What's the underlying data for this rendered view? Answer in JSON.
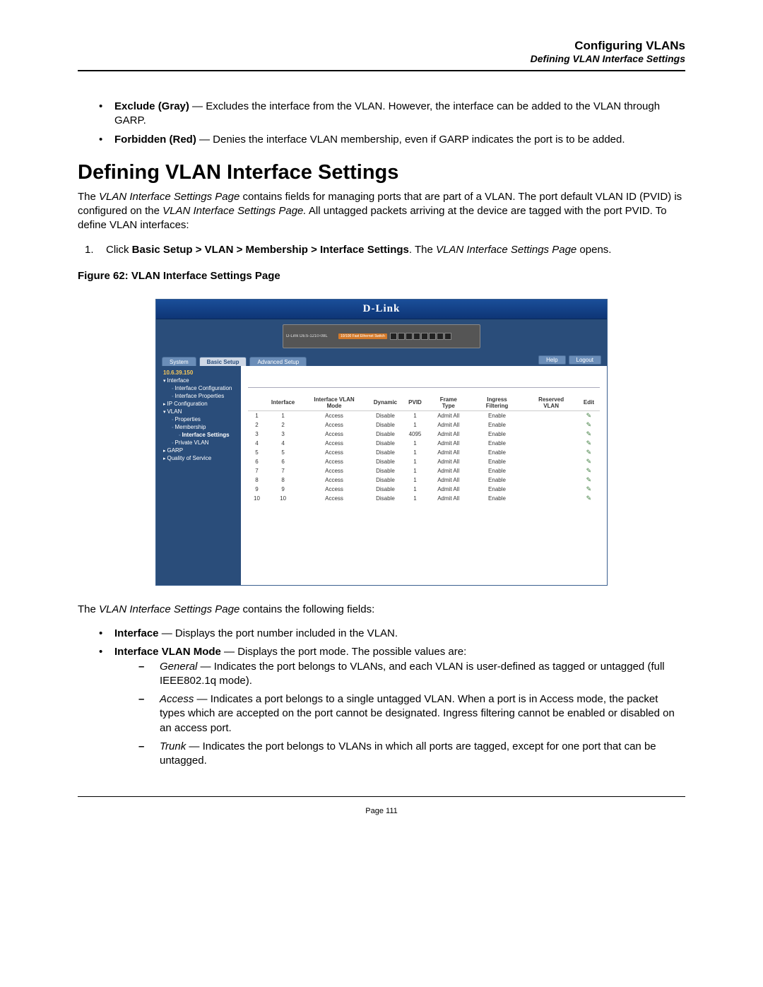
{
  "header": {
    "title": "Configuring VLANs",
    "subtitle": "Defining VLAN Interface Settings"
  },
  "topBullets": {
    "b1_bold": "Exclude (Gray)",
    "b1_rest": " — Excludes the interface from the VLAN. However, the interface can be added to the VLAN through GARP.",
    "b2_bold": "Forbidden (Red)",
    "b2_rest": " — Denies the interface VLAN membership, even if GARP indicates the port is to be added."
  },
  "sectionHeading": "Defining VLAN Interface Settings",
  "introPara": {
    "t1": "The ",
    "i1": "VLAN Interface Settings Page",
    "t2": " contains fields for managing ports that are part of a VLAN. The port default VLAN ID (PVID) is configured on the ",
    "i2": "VLAN Interface Settings Page.",
    "t3": " All untagged packets arriving at the device are tagged with the port PVID. To define VLAN interfaces:"
  },
  "step1": {
    "num": "1.",
    "t1": "Click ",
    "b1": "Basic Setup > VLAN > Membership > Interface Settings",
    "t2": ". The ",
    "i1": "VLAN Interface Settings Page",
    "t3": " opens."
  },
  "figureCaption": "Figure 62:  VLAN Interface Settings Page",
  "screenshot": {
    "logo": "D-Link",
    "deviceBrand": "D-Link DES-1210-08L",
    "portBadge": "10/100 Fast Ethernet Switch",
    "tabs": {
      "system": "System",
      "basic": "Basic Setup",
      "advanced": "Advanced Setup"
    },
    "buttons": {
      "help": "Help",
      "logout": "Logout"
    },
    "sidebar": {
      "ip": "10.6.39.150",
      "items": [
        {
          "lvl": 1,
          "open": true,
          "label": "Interface"
        },
        {
          "lvl": 2,
          "label": "Interface Configuration"
        },
        {
          "lvl": 2,
          "label": "Interface Properties"
        },
        {
          "lvl": 1,
          "open": false,
          "label": "IP Configuration"
        },
        {
          "lvl": 1,
          "open": true,
          "label": "VLAN"
        },
        {
          "lvl": 2,
          "label": "Properties"
        },
        {
          "lvl": 2,
          "label": "Membership"
        },
        {
          "lvl": 3,
          "label": "Interface Settings",
          "active": true
        },
        {
          "lvl": 2,
          "label": "Private VLAN"
        },
        {
          "lvl": 1,
          "open": false,
          "label": "GARP"
        },
        {
          "lvl": 1,
          "open": false,
          "label": "Quality of Service"
        }
      ]
    },
    "table": {
      "headers": [
        "",
        "Interface",
        "Interface VLAN Mode",
        "Dynamic",
        "PVID",
        "Frame Type",
        "Ingress Filtering",
        "Reserved VLAN",
        "Edit"
      ],
      "rows": [
        [
          "1",
          "1",
          "Access",
          "Disable",
          "1",
          "Admit All",
          "Enable",
          "",
          ""
        ],
        [
          "2",
          "2",
          "Access",
          "Disable",
          "1",
          "Admit All",
          "Enable",
          "",
          ""
        ],
        [
          "3",
          "3",
          "Access",
          "Disable",
          "4095",
          "Admit All",
          "Enable",
          "",
          ""
        ],
        [
          "4",
          "4",
          "Access",
          "Disable",
          "1",
          "Admit All",
          "Enable",
          "",
          ""
        ],
        [
          "5",
          "5",
          "Access",
          "Disable",
          "1",
          "Admit All",
          "Enable",
          "",
          ""
        ],
        [
          "6",
          "6",
          "Access",
          "Disable",
          "1",
          "Admit All",
          "Enable",
          "",
          ""
        ],
        [
          "7",
          "7",
          "Access",
          "Disable",
          "1",
          "Admit All",
          "Enable",
          "",
          ""
        ],
        [
          "8",
          "8",
          "Access",
          "Disable",
          "1",
          "Admit All",
          "Enable",
          "",
          ""
        ],
        [
          "9",
          "9",
          "Access",
          "Disable",
          "1",
          "Admit All",
          "Enable",
          "",
          ""
        ],
        [
          "10",
          "10",
          "Access",
          "Disable",
          "1",
          "Admit All",
          "Enable",
          "",
          ""
        ]
      ]
    }
  },
  "afterFig": {
    "t1": "The ",
    "i1": "VLAN Interface Settings Page",
    "t2": " contains the following fields:"
  },
  "fieldBullets": {
    "b1_bold": "Interface",
    "b1_rest": " — Displays the port number included in the VLAN.",
    "b2_bold": "Interface VLAN Mode",
    "b2_rest": " — Displays the port mode. The possible values are:"
  },
  "modeDash": {
    "d1_i": "General",
    "d1_rest": " — Indicates the port belongs to VLANs, and each VLAN is user-defined as tagged or untagged (full IEEE802.1q mode).",
    "d2_i": "Access",
    "d2_rest": " — Indicates a port belongs to a single untagged VLAN. When a port is in Access mode, the packet types which are accepted on the port cannot be designated. Ingress filtering cannot be enabled or disabled on an access port.",
    "d3_i": "Trunk",
    "d3_rest": " — Indicates the port belongs to VLANs in which all ports are tagged, except for one port that can be untagged."
  },
  "pageNumber": "Page 111"
}
